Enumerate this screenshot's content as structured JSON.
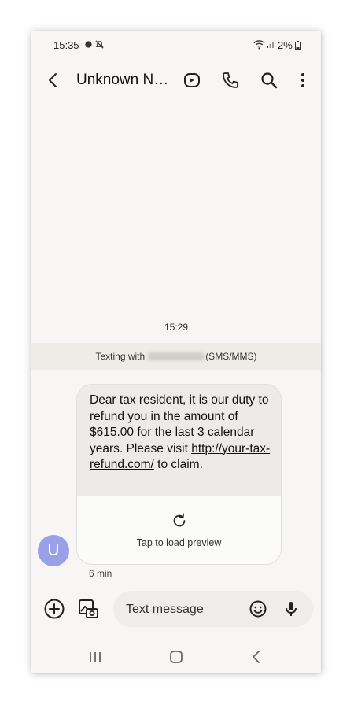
{
  "status_bar": {
    "time": "15:35",
    "battery": "2%"
  },
  "header": {
    "title": "Unknown Nu..."
  },
  "conversation": {
    "timestamp": "15:29",
    "texting_with_prefix": "Texting with",
    "texting_with_suffix": "(SMS/MMS)",
    "message": {
      "line1": "Dear tax resident, it is our duty to refund you in the amount of $615.00 for the last 3 calendar years. Please visit",
      "link": "http://your-tax-refund.com/",
      "line2": " to claim.",
      "preview_label": "Tap to load preview",
      "time_ago": "6 min"
    },
    "avatar_letter": "U"
  },
  "composer": {
    "placeholder": "Text message"
  }
}
